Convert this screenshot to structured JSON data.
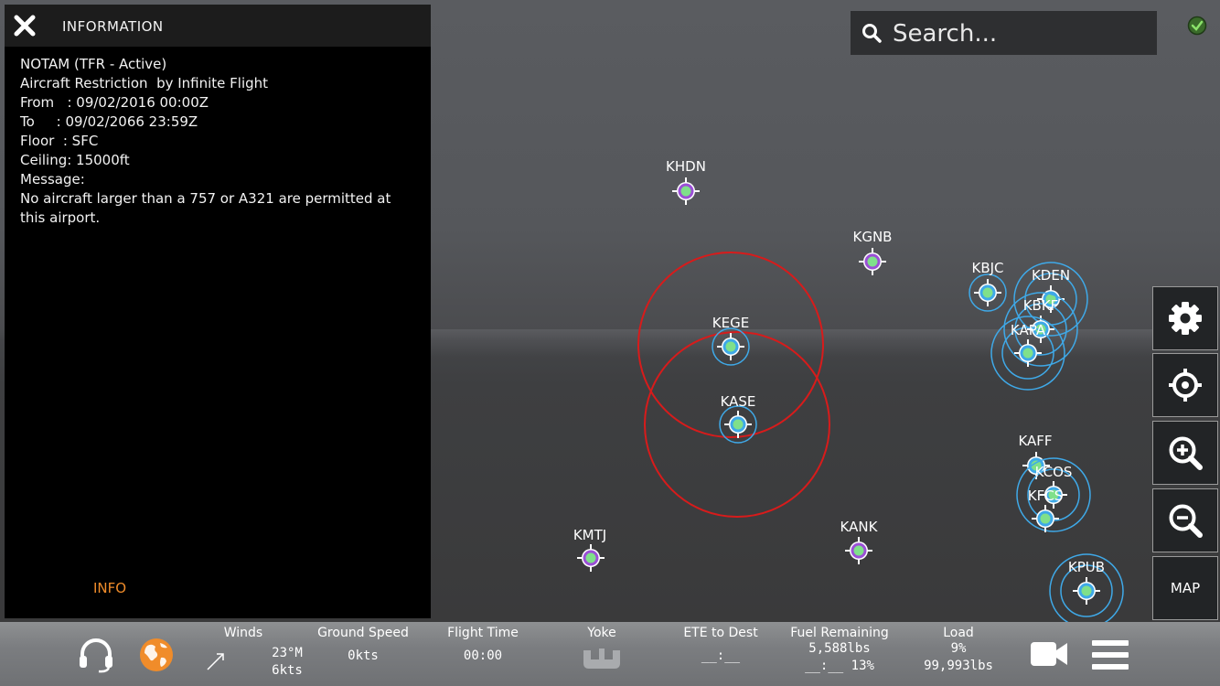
{
  "info_panel": {
    "title": "INFORMATION",
    "lines": [
      "NOTAM (TFR - Active)",
      "Aircraft Restriction  by Infinite Flight",
      "From   : 09/02/2016 00:00Z",
      "To     : 09/02/2066 23:59Z",
      "Floor  : SFC",
      "Ceiling: 15000ft",
      "Message:",
      "No aircraft larger than a 757 or A321 are permitted at this airport."
    ],
    "tab_label": "INFO"
  },
  "search": {
    "placeholder": "Search..."
  },
  "airports": [
    {
      "code": "KHDN",
      "kind": "small"
    },
    {
      "code": "KGNB",
      "kind": "small"
    },
    {
      "code": "KEGE",
      "kind": "atc"
    },
    {
      "code": "KASE",
      "kind": "atc"
    },
    {
      "code": "KBJC",
      "kind": "atc"
    },
    {
      "code": "KDEN",
      "kind": "atc"
    },
    {
      "code": "KBKF",
      "kind": "atc"
    },
    {
      "code": "KAPA",
      "kind": "atc"
    },
    {
      "code": "KAFF",
      "kind": "atc"
    },
    {
      "code": "KCOS",
      "kind": "atc"
    },
    {
      "code": "KFCS",
      "kind": "atc"
    },
    {
      "code": "KMTJ",
      "kind": "small"
    },
    {
      "code": "KANK",
      "kind": "small"
    },
    {
      "code": "KPUB",
      "kind": "atc"
    }
  ],
  "right_buttons": {
    "map_label": "MAP"
  },
  "stats": {
    "winds_label": "Winds",
    "winds_dir": "23°M",
    "winds_speed": "6kts",
    "ground_speed_label": "Ground Speed",
    "ground_speed": "0kts",
    "flight_time_label": "Flight Time",
    "flight_time": "00:00",
    "yoke_label": "Yoke",
    "ete_label": "ETE to Dest",
    "ete": "__:__",
    "fuel_label": "Fuel Remaining",
    "fuel_lbs": "5,588lbs",
    "fuel_time": "__:__ 13%",
    "load_label": "Load",
    "load_pct": "9%",
    "load_lbs": "99,993lbs"
  },
  "colors": {
    "accent_orange": "#f08c2a",
    "tfr_red": "#d81b1b",
    "atc_blue": "#3fa9e8",
    "airport_green": "#7fe08a",
    "small_airport_purple": "#9b4fd6"
  },
  "icons": [
    "close-icon",
    "search-icon",
    "online-check-icon",
    "gear-icon",
    "crosshair-icon",
    "zoom-in-icon",
    "zoom-out-icon",
    "headset-icon",
    "globe-icon",
    "wind-arrow-icon",
    "yoke-icon",
    "camera-icon",
    "menu-icon"
  ]
}
